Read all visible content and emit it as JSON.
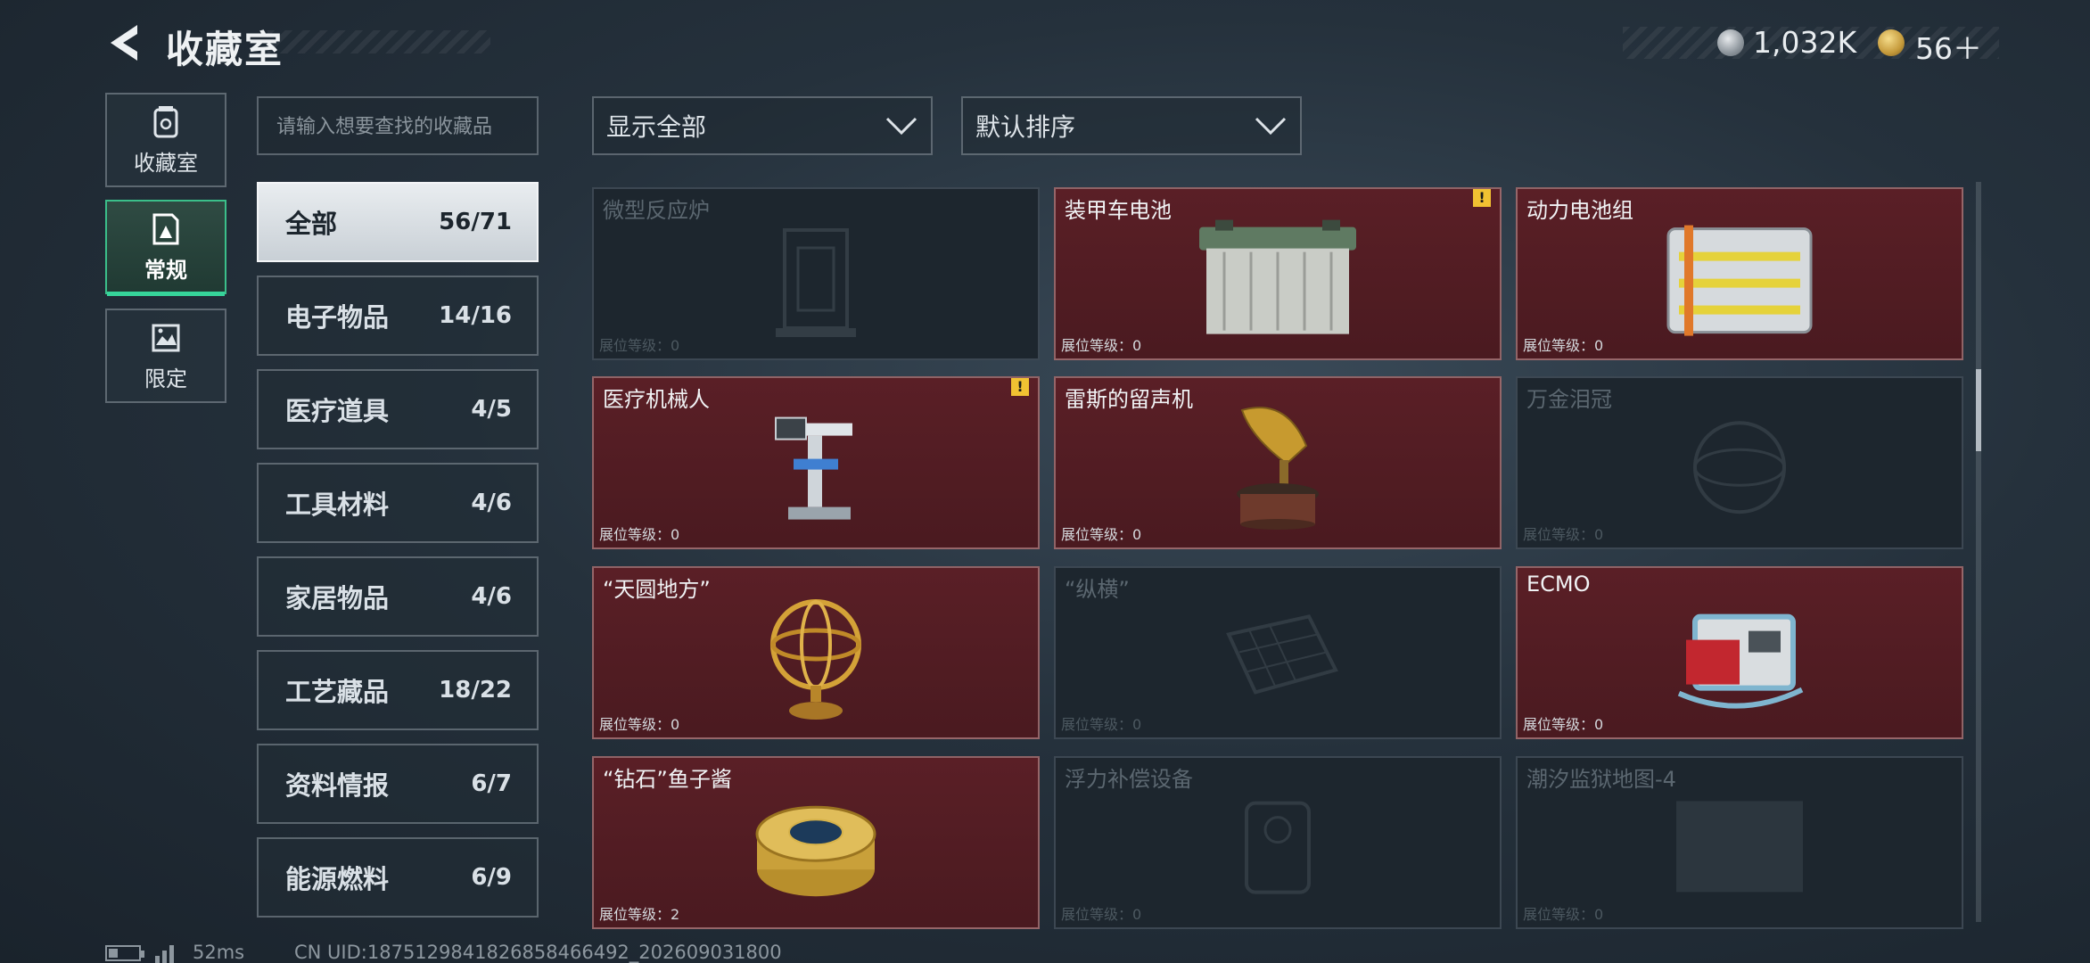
{
  "header": {
    "title": "收藏室",
    "currencies": [
      {
        "icon": "silver-coin-icon",
        "value": "1,032K"
      },
      {
        "icon": "gold-triangle-coin-icon",
        "value": "56＋"
      }
    ]
  },
  "side_tabs": [
    {
      "label": "收藏室",
      "icon": "collection-jar-icon",
      "active": false
    },
    {
      "label": "常规",
      "icon": "framed-picture-icon",
      "active": true
    },
    {
      "label": "限定",
      "icon": "landscape-picture-icon",
      "active": false
    }
  ],
  "search": {
    "placeholder": "请输入想要查找的收藏品"
  },
  "categories": [
    {
      "name": "全部",
      "count": "56/71",
      "active": true
    },
    {
      "name": "电子物品",
      "count": "14/16"
    },
    {
      "name": "医疗道具",
      "count": "4/5"
    },
    {
      "name": "工具材料",
      "count": "4/6"
    },
    {
      "name": "家居物品",
      "count": "4/6"
    },
    {
      "name": "工艺藏品",
      "count": "18/22"
    },
    {
      "name": "资料情报",
      "count": "6/7"
    },
    {
      "name": "能源燃料",
      "count": "6/9"
    }
  ],
  "filters": {
    "display": "显示全部",
    "sort": "默认排序"
  },
  "items": [
    {
      "name": "微型反应炉",
      "level": "展位等级：0",
      "owned": false,
      "alert": false,
      "icon": "reactor-icon"
    },
    {
      "name": "装甲车电池",
      "level": "展位等级：0",
      "owned": true,
      "alert": true,
      "icon": "vehicle-battery-icon"
    },
    {
      "name": "动力电池组",
      "level": "展位等级：0",
      "owned": true,
      "alert": false,
      "icon": "battery-pack-icon"
    },
    {
      "name": "医疗机械人",
      "level": "展位等级：0",
      "owned": true,
      "alert": true,
      "icon": "medical-robot-icon"
    },
    {
      "name": "雷斯的留声机",
      "level": "展位等级：0",
      "owned": true,
      "alert": false,
      "icon": "gramophone-icon"
    },
    {
      "name": "万金泪冠",
      "level": "展位等级：0",
      "owned": false,
      "alert": false,
      "icon": "crown-icon"
    },
    {
      "name": "“天圆地方”",
      "level": "展位等级：0",
      "owned": true,
      "alert": false,
      "icon": "armillary-sphere-icon"
    },
    {
      "name": "“纵横”",
      "level": "展位等级：0",
      "owned": false,
      "alert": false,
      "icon": "chessboard-icon"
    },
    {
      "name": "ECMO",
      "level": "展位等级：0",
      "owned": true,
      "alert": false,
      "icon": "ecmo-machine-icon"
    },
    {
      "name": "“钻石”鱼子酱",
      "level": "展位等级：2",
      "owned": true,
      "alert": false,
      "icon": "caviar-tin-icon"
    },
    {
      "name": "浮力补偿设备",
      "level": "展位等级：0",
      "owned": false,
      "alert": false,
      "icon": "buoyancy-device-icon"
    },
    {
      "name": "潮汐监狱地图-4",
      "level": "展位等级：0",
      "owned": false,
      "alert": false,
      "icon": "map-icon"
    }
  ],
  "alert_mark": "!",
  "footer": {
    "ping": "52ms",
    "uid": "CN UID:1875129841826858466492_202609031800"
  },
  "colors": {
    "accent_green": "#36d49a",
    "owned_card": "#5a1f26",
    "alert_yellow": "#f1c232"
  }
}
